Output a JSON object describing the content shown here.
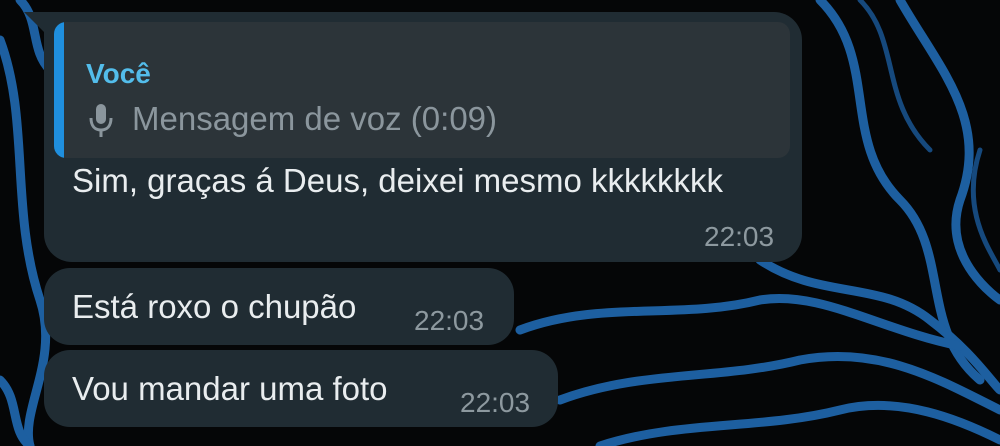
{
  "chat": {
    "messages": [
      {
        "quoted": {
          "author": "Você",
          "type_icon": "microphone-icon",
          "text": "Mensagem de voz (0:09)"
        },
        "text": "Sim, graças á Deus, deixei mesmo kkkkkkkk",
        "time": "22:03"
      },
      {
        "text": "Está roxo o chupão",
        "time": "22:03"
      },
      {
        "text": "Vou mandar uma foto",
        "time": "22:03"
      }
    ]
  },
  "theme": {
    "bubble_color": "#202c33",
    "quote_background": "#2c3439",
    "quote_accent": "#1f8fde",
    "quote_author_color": "#53bdeb",
    "wallpaper_line_color": "#1d5fa0"
  }
}
